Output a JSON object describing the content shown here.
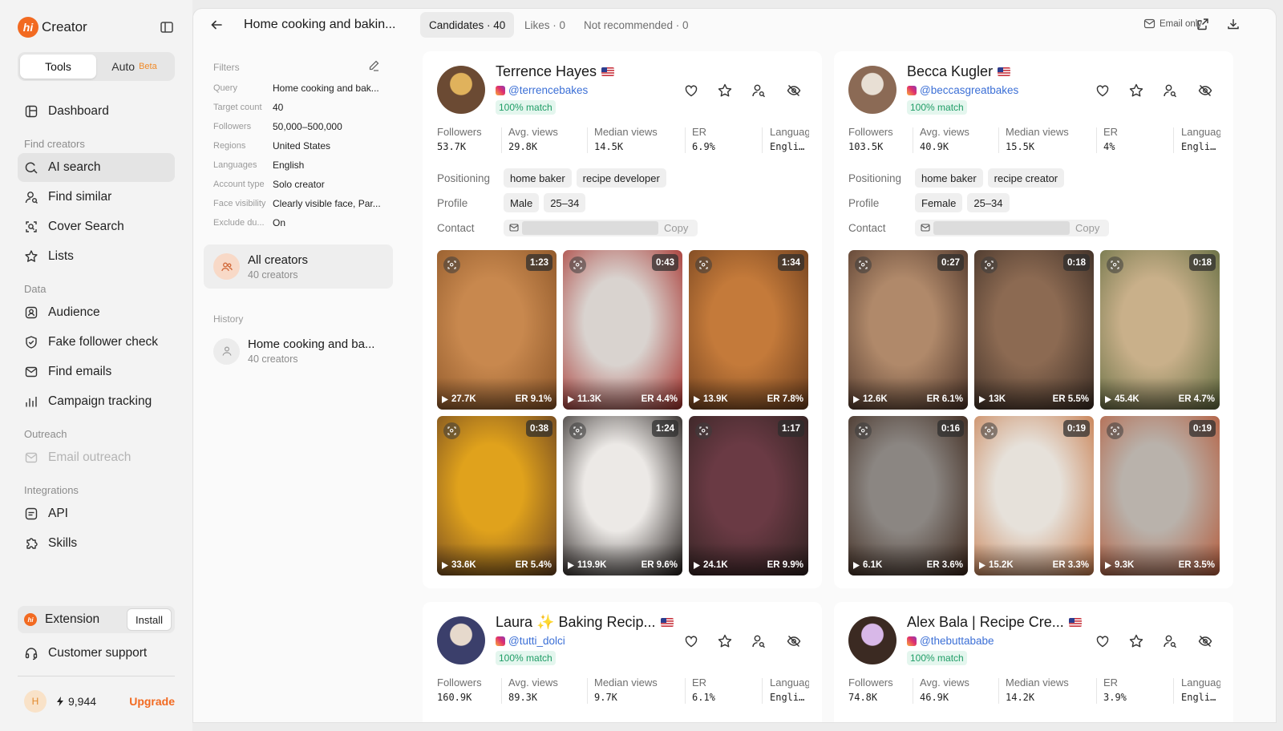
{
  "brand": {
    "name": "Creator",
    "logo_text": "hi"
  },
  "mode": {
    "tools": "Tools",
    "auto": "Auto",
    "beta": "Beta"
  },
  "nav": {
    "dashboard": "Dashboard",
    "find_creators_section": "Find creators",
    "ai_search": "AI search",
    "find_similar": "Find similar",
    "cover_search": "Cover Search",
    "lists": "Lists",
    "data_section": "Data",
    "audience": "Audience",
    "fake_follower_check": "Fake follower check",
    "find_emails": "Find emails",
    "campaign_tracking": "Campaign tracking",
    "outreach_section": "Outreach",
    "email_outreach": "Email outreach",
    "integrations_section": "Integrations",
    "api": "API",
    "skills": "Skills"
  },
  "extension": {
    "label": "Extension",
    "install": "Install",
    "logo_text": "hi"
  },
  "support": "Customer support",
  "account": {
    "initial": "H",
    "credits": "9,944",
    "upgrade": "Upgrade"
  },
  "topbar": {
    "title": "Home cooking and bakin...",
    "tab_candidates": "Candidates · 40",
    "tab_likes": "Likes · 0",
    "tab_not_recommended": "Not recommended · 0",
    "email_only": "Email only"
  },
  "filters": {
    "heading": "Filters",
    "rows": [
      {
        "key": "Query",
        "value": "Home cooking and bak..."
      },
      {
        "key": "Target count",
        "value": "40"
      },
      {
        "key": "Followers",
        "value": "50,000–500,000"
      },
      {
        "key": "Regions",
        "value": "United States"
      },
      {
        "key": "Languages",
        "value": "English"
      },
      {
        "key": "Account type",
        "value": "Solo creator"
      },
      {
        "key": "Face visibility",
        "value": "Clearly visible face, Par..."
      },
      {
        "key": "Exclude du...",
        "value": "On"
      }
    ],
    "all_creators": {
      "title": "All creators",
      "count": "40 creators"
    },
    "history_label": "History",
    "history": [
      {
        "title": "Home cooking and ba...",
        "count": "40 creators"
      }
    ]
  },
  "labels": {
    "followers": "Followers",
    "avg_views": "Avg. views",
    "median_views": "Median views",
    "er": "ER",
    "language": "Languag",
    "positioning": "Positioning",
    "profile": "Profile",
    "contact": "Contact",
    "copy": "Copy",
    "match": "100% match"
  },
  "creators": [
    {
      "name": "Terrence Hayes",
      "handle": "@terrencebakes",
      "stats": {
        "followers": "53.7K",
        "avg_views": "29.8K",
        "median_views": "14.5K",
        "er": "6.9%",
        "language": "Engli…"
      },
      "positioning": [
        "home baker",
        "recipe developer"
      ],
      "profile": [
        "Male",
        "25–34"
      ],
      "videos": [
        {
          "duration": "1:23",
          "views": "27.7K",
          "er": "ER 9.1%",
          "colors": [
            "#c8884e",
            "#8a5427"
          ]
        },
        {
          "duration": "0:43",
          "views": "11.3K",
          "er": "ER 4.4%",
          "colors": [
            "#d9d3cf",
            "#a52f2a"
          ]
        },
        {
          "duration": "1:34",
          "views": "13.9K",
          "er": "ER 7.8%",
          "colors": [
            "#c47a3a",
            "#6b3d1d"
          ]
        },
        {
          "duration": "0:38",
          "views": "33.6K",
          "er": "ER 5.4%",
          "colors": [
            "#e0a21c",
            "#6b4322"
          ]
        },
        {
          "duration": "1:24",
          "views": "119.9K",
          "er": "ER 9.6%",
          "colors": [
            "#ece9e6",
            "#201a18"
          ]
        },
        {
          "duration": "1:17",
          "views": "24.1K",
          "er": "ER 9.9%",
          "colors": [
            "#6a3a44",
            "#2f2220"
          ]
        }
      ]
    },
    {
      "name": "Becca Kugler",
      "handle": "@beccasgreatbakes",
      "stats": {
        "followers": "103.5K",
        "avg_views": "40.9K",
        "median_views": "15.5K",
        "er": "4%",
        "language": "Engli…"
      },
      "positioning": [
        "home baker",
        "recipe creator"
      ],
      "profile": [
        "Female",
        "25–34"
      ],
      "videos": [
        {
          "duration": "0:27",
          "views": "12.6K",
          "er": "ER 6.1%",
          "colors": [
            "#b0896a",
            "#4b3328"
          ]
        },
        {
          "duration": "0:18",
          "views": "13K",
          "er": "ER 5.5%",
          "colors": [
            "#8c6a52",
            "#3a2c24"
          ]
        },
        {
          "duration": "0:18",
          "views": "45.4K",
          "er": "ER 4.7%",
          "colors": [
            "#c9b08a",
            "#5f6a3e"
          ]
        },
        {
          "duration": "0:16",
          "views": "6.1K",
          "er": "ER 3.6%",
          "colors": [
            "#8b8682",
            "#3a2418"
          ]
        },
        {
          "duration": "0:19",
          "views": "15.2K",
          "er": "ER 3.3%",
          "colors": [
            "#e6e1da",
            "#c77a4a"
          ]
        },
        {
          "duration": "0:19",
          "views": "9.3K",
          "er": "ER 3.5%",
          "colors": [
            "#b9b2ab",
            "#b45a3a"
          ]
        }
      ]
    },
    {
      "name": "Laura ✨ Baking Recip...",
      "handle": "@tutti_dolci",
      "stats": {
        "followers": "160.9K",
        "avg_views": "89.3K",
        "median_views": "9.7K",
        "er": "6.1%",
        "language": "Engli…"
      }
    },
    {
      "name": "Alex Bala | Recipe Cre...",
      "handle": "@thebuttababe",
      "stats": {
        "followers": "74.8K",
        "avg_views": "46.9K",
        "median_views": "14.2K",
        "er": "3.9%",
        "language": "Engli…"
      }
    }
  ]
}
